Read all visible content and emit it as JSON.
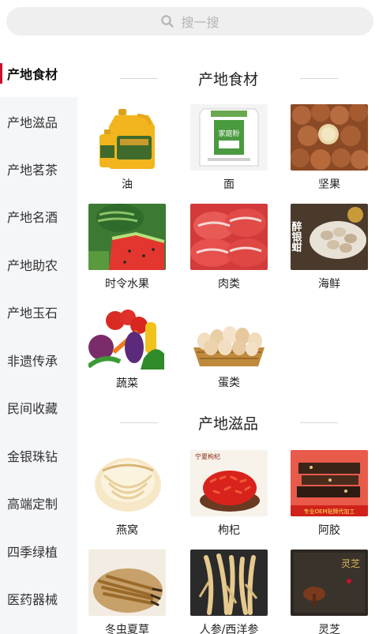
{
  "search": {
    "placeholder": "搜一搜",
    "icon": "search-icon"
  },
  "sidebar": {
    "active_index": 0,
    "items": [
      {
        "label": "产地食材"
      },
      {
        "label": "产地滋品"
      },
      {
        "label": "产地茗茶"
      },
      {
        "label": "产地名酒"
      },
      {
        "label": "产地助农"
      },
      {
        "label": "产地玉石"
      },
      {
        "label": "非遗传承"
      },
      {
        "label": "民间收藏"
      },
      {
        "label": "金银珠钻"
      },
      {
        "label": "高端定制"
      },
      {
        "label": "四季绿植"
      },
      {
        "label": "医药器械"
      }
    ]
  },
  "sections": [
    {
      "title": "产地食材",
      "items": [
        {
          "label": "油",
          "image": "oil-image"
        },
        {
          "label": "面",
          "image": "flour-image",
          "image_text": "家庭粉"
        },
        {
          "label": "坚果",
          "image": "nuts-image"
        },
        {
          "label": "时令水果",
          "image": "watermelon-image"
        },
        {
          "label": "肉类",
          "image": "meat-image"
        },
        {
          "label": "海鲜",
          "image": "seafood-image",
          "image_text": "醉银蚶"
        },
        {
          "label": "蔬菜",
          "image": "vegetables-image"
        },
        {
          "label": "蛋类",
          "image": "eggs-image"
        }
      ]
    },
    {
      "title": "产地滋品",
      "items": [
        {
          "label": "燕窝",
          "image": "birdnest-image"
        },
        {
          "label": "枸杞",
          "image": "goji-image",
          "image_text": "宁夏枸杞"
        },
        {
          "label": "阿胶",
          "image": "ejiao-image",
          "image_text": "专业OEM贴牌代加工"
        },
        {
          "label": "冬虫夏草",
          "image": "cordyceps-image"
        },
        {
          "label": "人参/西洋参",
          "image": "ginseng-image"
        },
        {
          "label": "灵芝",
          "image": "lingzhi-image",
          "image_text": "灵芝"
        }
      ]
    }
  ],
  "colors": {
    "accent": "#c8102e",
    "sidebar_bg": "#f5f6f8",
    "search_bg": "#efefef"
  }
}
